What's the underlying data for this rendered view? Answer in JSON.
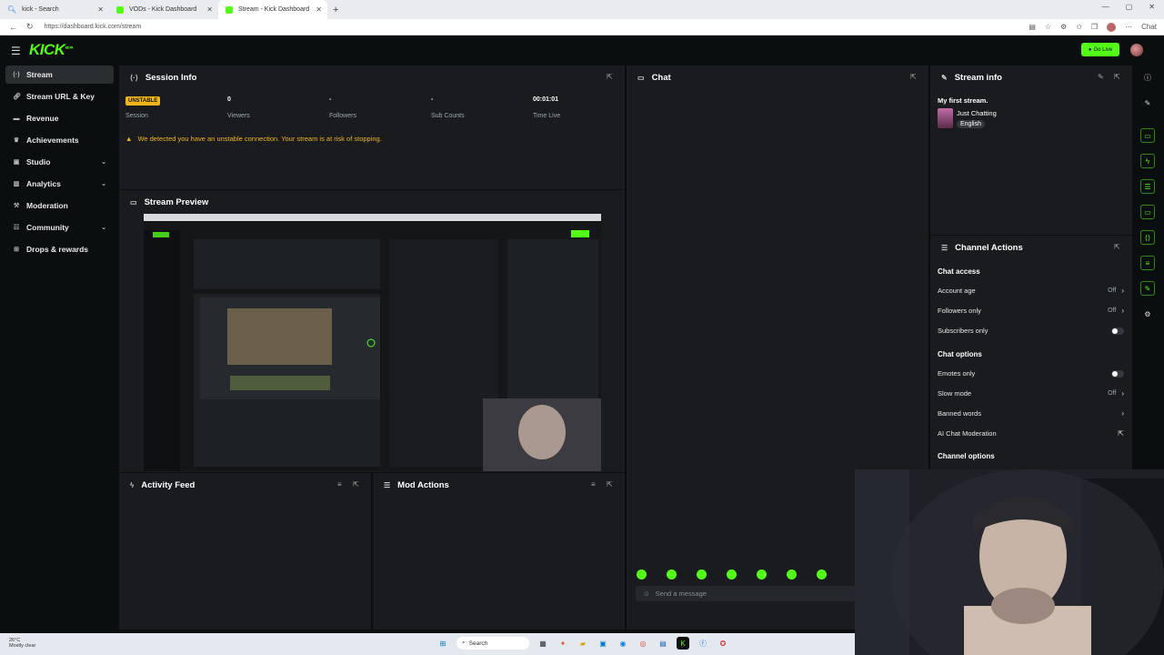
{
  "browser": {
    "tabs": [
      {
        "title": "kick - Search",
        "icon": "search-icon"
      },
      {
        "title": "VODs - Kick Dashboard",
        "icon": "kick-favicon"
      },
      {
        "title": "Stream - Kick Dashboard",
        "icon": "kick-favicon",
        "active": true
      }
    ],
    "url": "https://dashboard.kick.com/stream",
    "chat_button": "Chat"
  },
  "header": {
    "logo": "KICK",
    "logo_badge": "BETA",
    "go_live": "Go Live"
  },
  "sidebar": {
    "items": [
      {
        "label": "Stream",
        "icon": "broadcast-icon",
        "active": true
      },
      {
        "label": "Stream URL & Key",
        "icon": "link-icon"
      },
      {
        "label": "Revenue",
        "icon": "wallet-icon"
      },
      {
        "label": "Achievements",
        "icon": "trophy-icon"
      },
      {
        "label": "Studio",
        "icon": "studio-icon",
        "expandable": true
      },
      {
        "label": "Analytics",
        "icon": "chart-icon",
        "expandable": true
      },
      {
        "label": "Moderation",
        "icon": "hammer-icon"
      },
      {
        "label": "Community",
        "icon": "users-icon",
        "expandable": true
      },
      {
        "label": "Drops & rewards",
        "icon": "gift-icon"
      }
    ]
  },
  "session": {
    "title": "Session Info",
    "status": "UNSTABLE",
    "status_label": "Session",
    "viewers": "0",
    "viewers_label": "Viewers",
    "followers": "-",
    "followers_label": "Followers",
    "subs": "-",
    "subs_label": "Sub Counts",
    "time": "00:01:01",
    "time_label": "Time Live",
    "warning": "We detected you have an unstable connection. Your stream is at risk of stopping."
  },
  "preview": {
    "title": "Stream Preview"
  },
  "activity": {
    "title": "Activity Feed"
  },
  "mod_actions": {
    "title": "Mod Actions"
  },
  "chat": {
    "title": "Chat",
    "placeholder": "Send a message"
  },
  "stream_info": {
    "title": "Stream info",
    "stream_title": "My first stream.",
    "category": "Just Chatting",
    "language": "English"
  },
  "channel_actions": {
    "title": "Channel Actions",
    "chat_access": "Chat access",
    "account_age": "Account age",
    "account_age_val": "Off",
    "followers_only": "Followers only",
    "followers_only_val": "Off",
    "subscribers_only": "Subscribers only",
    "chat_options": "Chat options",
    "emotes_only": "Emotes only",
    "slow_mode": "Slow mode",
    "slow_mode_val": "Off",
    "banned_words": "Banned words",
    "ai_moderation": "AI Chat Moderation",
    "channel_options": "Channel options"
  },
  "taskbar": {
    "weather_temp": "26°C",
    "weather_desc": "Mostly clear",
    "search": "Search"
  },
  "colors": {
    "accent": "#53fc18",
    "warning": "#f2b51c",
    "panel": "#191b1f",
    "background": "#0b0e0f"
  }
}
